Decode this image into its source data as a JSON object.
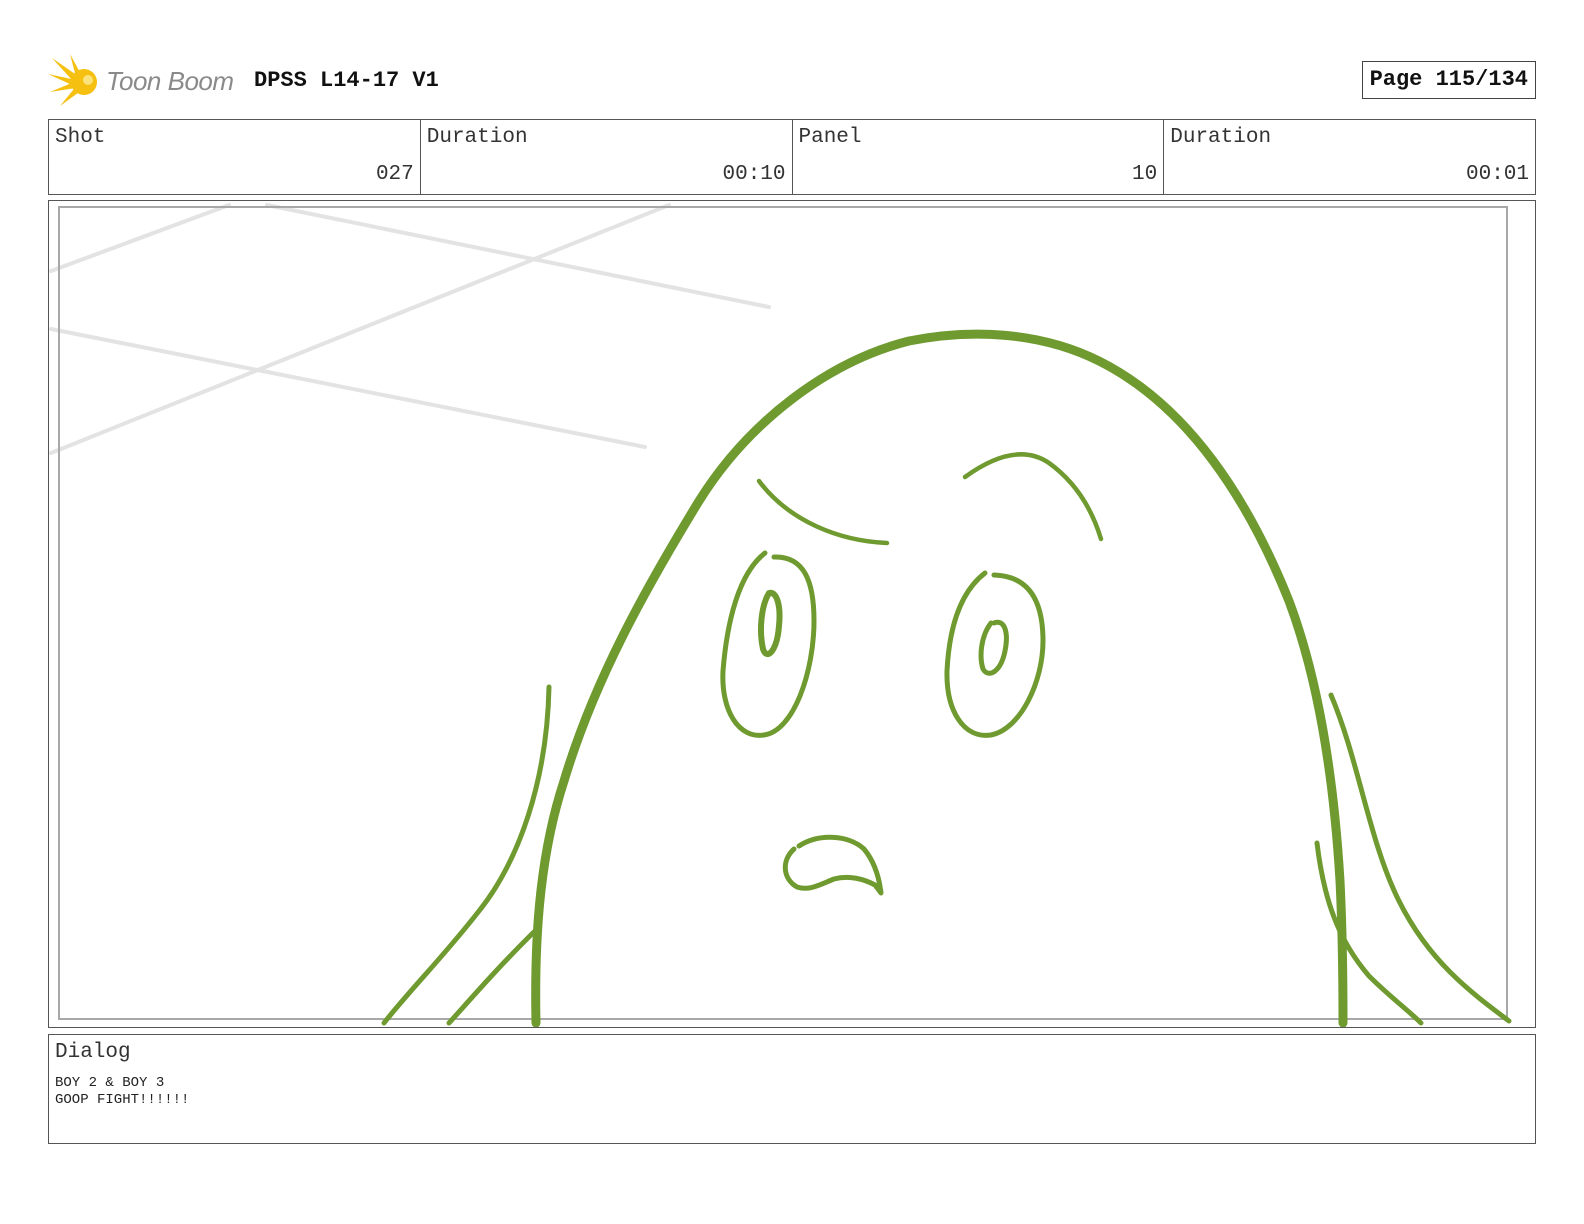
{
  "header": {
    "logo_text": "Toon Boom",
    "project_title": "DPSS L14-17 V1",
    "page_label": "Page 115/134"
  },
  "info": [
    {
      "label": "Shot",
      "value": "027"
    },
    {
      "label": "Duration",
      "value": "00:10"
    },
    {
      "label": "Panel",
      "value": "10"
    },
    {
      "label": "Duration",
      "value": "00:01"
    }
  ],
  "colors": {
    "sketch_line": "#6f9a30",
    "background_lines": "#e3e3e3",
    "safe_frame": "#a8a8a8",
    "logo_burst": "#f5c010"
  },
  "icons": {
    "logo": "starburst-icon"
  },
  "dialog": {
    "label": "Dialog",
    "line1": "BOY 2 & BOY 3",
    "line2": "GOOP FIGHT!!!!!!"
  }
}
